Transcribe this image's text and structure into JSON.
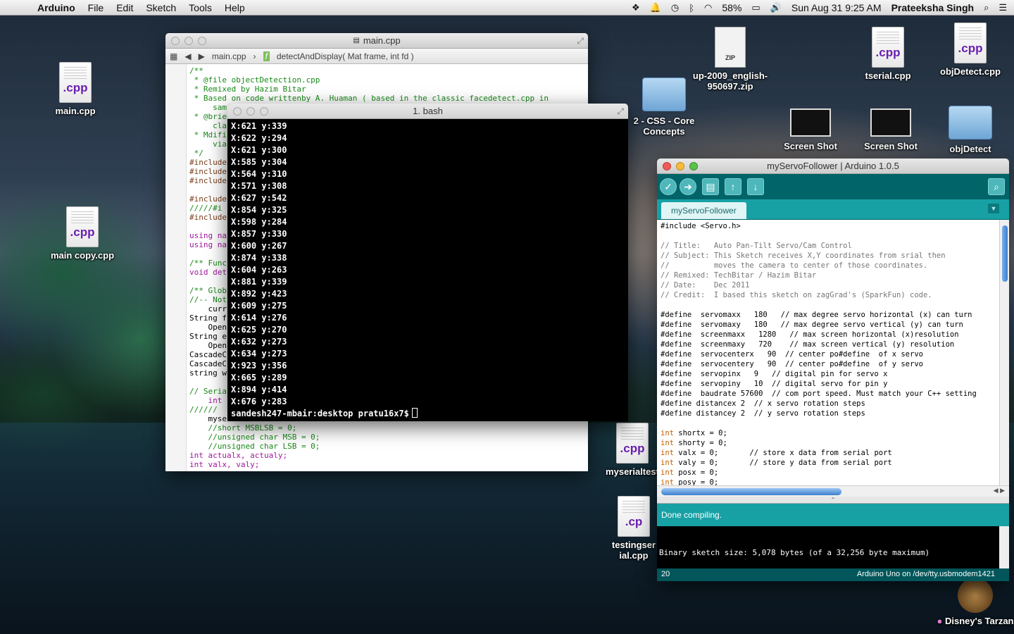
{
  "menubar": {
    "app": "Arduino",
    "items": [
      "File",
      "Edit",
      "Sketch",
      "Tools",
      "Help"
    ],
    "battery": "58%",
    "clock": "Sun Aug 31  9:25 AM",
    "user": "Prateeksha Singh"
  },
  "desktop_icons": [
    {
      "label": "main.cpp",
      "ext": ".cpp",
      "kind": "doc"
    },
    {
      "label": "main copy.cpp",
      "ext": ".cpp",
      "kind": "doc"
    },
    {
      "label": "up-2009_english-950697.zip",
      "ext": "ZIP",
      "kind": "zip"
    },
    {
      "label": "tserial.cpp",
      "ext": ".cpp",
      "kind": "doc"
    },
    {
      "label": "objDetect.cpp",
      "ext": ".cpp",
      "kind": "doc"
    },
    {
      "label": "2 - CSS - Core Concepts",
      "kind": "folder"
    },
    {
      "label": "Screen Shot",
      "kind": "shot"
    },
    {
      "label": "Screen Shot",
      "kind": "shot"
    },
    {
      "label": "objDetect",
      "kind": "folder"
    },
    {
      "label": "myserialtest",
      "ext": ".cpp",
      "kind": "doc"
    },
    {
      "label": "testingserial.cpp",
      "ext": ".cp",
      "kind": "doc"
    },
    {
      "label": "Disney's Tarzan",
      "kind": "app"
    }
  ],
  "xcode": {
    "title": "main.cpp",
    "jump_file": "main.cpp",
    "jump_func": "detectAndDisplay( Mat frame, int fd )",
    "lines": [
      "/**",
      " * @file objectDetection.cpp",
      " * Remixed by Hazim Bitar",
      " * Based on code writtenby A. Huaman ( based in the classic facedetect.cpp in",
      "     sam",
      " * @brie",
      "     cla",
      " * Mdifi",
      "     via",
      " */",
      "#include",
      "#include",
      "#include",
      "",
      "#include",
      "/////#i",
      "#include",
      "",
      "using na",
      "using na",
      "",
      "/** Func",
      "void det",
      "",
      "/** Glob",
      "//-- Not",
      "    curr",
      "String f",
      "    Open",
      "String e",
      "    Open",
      "CascadeC",
      "CascadeC",
      "string w",
      "",
      "// Seria",
      "    int",
      "//////",
      "    myse",
      "    //short MSBLSB = 0;",
      "    //unsigned char MSB = 0;",
      "    //unsigned char LSB = 0;",
      "int actualx, actualy;",
      "int valx, valy;"
    ]
  },
  "terminal": {
    "title": "1. bash",
    "lines": [
      "X:621  y:339",
      "X:622  y:294",
      "X:621  y:300",
      "X:585  y:304",
      "X:564  y:310",
      "X:571  y:308",
      "X:627  y:542",
      "X:854  y:325",
      "X:598  y:284",
      "X:857  y:330",
      "X:600  y:267",
      "X:874  y:338",
      "X:604  y:263",
      "X:881  y:339",
      "X:892  y:423",
      "X:609  y:275",
      "X:614  y:276",
      "X:625  y:270",
      "X:632  y:273",
      "X:634  y:273",
      "X:923  y:356",
      "X:665  y:289",
      "X:894  y:414",
      "X:676  y:283"
    ],
    "prompt": "sandesh247-mbair:desktop pratu16x7$"
  },
  "arduino": {
    "title": "myServoFollower | Arduino 1.0.5",
    "tab": "myServoFollower",
    "code": [
      "#include <Servo.h>",
      "",
      "// Title:   Auto Pan-Tilt Servo/Cam Control",
      "// Subject: This Sketch receives X,Y coordinates from srial then",
      "//          moves the camera to center of those coordinates.",
      "// Remixed: TechBitar / Hazim Bitar",
      "// Date:    Dec 2011",
      "// Credit:  I based this sketch on zagGrad's (SparkFun) code.",
      "",
      "#define  servomaxx   180   // max degree servo horizontal (x) can turn",
      "#define  servomaxy   180   // max degree servo vertical (y) can turn",
      "#define  screenmaxx   1280   // max screen horizontal (x)resolution",
      "#define  screenmaxy   720    // max screen vertical (y) resolution",
      "#define  servocenterx   90  // center po#define  of x servo",
      "#define  servocentery   90  // center po#define  of y servo",
      "#define  servopinx   9   // digital pin for servo x",
      "#define  servopiny   10  // digital servo for pin y",
      "#define  baudrate 57600  // com port speed. Must match your C++ setting",
      "#define distancex 2  // x servo rotation steps",
      "#define distancey 2  // y servo rotation steps",
      "",
      "int shortx = 0;",
      "int shorty = 0;",
      "int valx = 0;       // store x data from serial port",
      "int valy = 0;       // store y data from serial port",
      "int posx = 0;",
      "int posy = 0;"
    ],
    "status": "Done compiling.",
    "console": "Binary sketch size: 5,078 bytes (of a 32,256 byte maximum)",
    "line_number": "20",
    "board": "Arduino Uno on /dev/tty.usbmodem1421"
  }
}
